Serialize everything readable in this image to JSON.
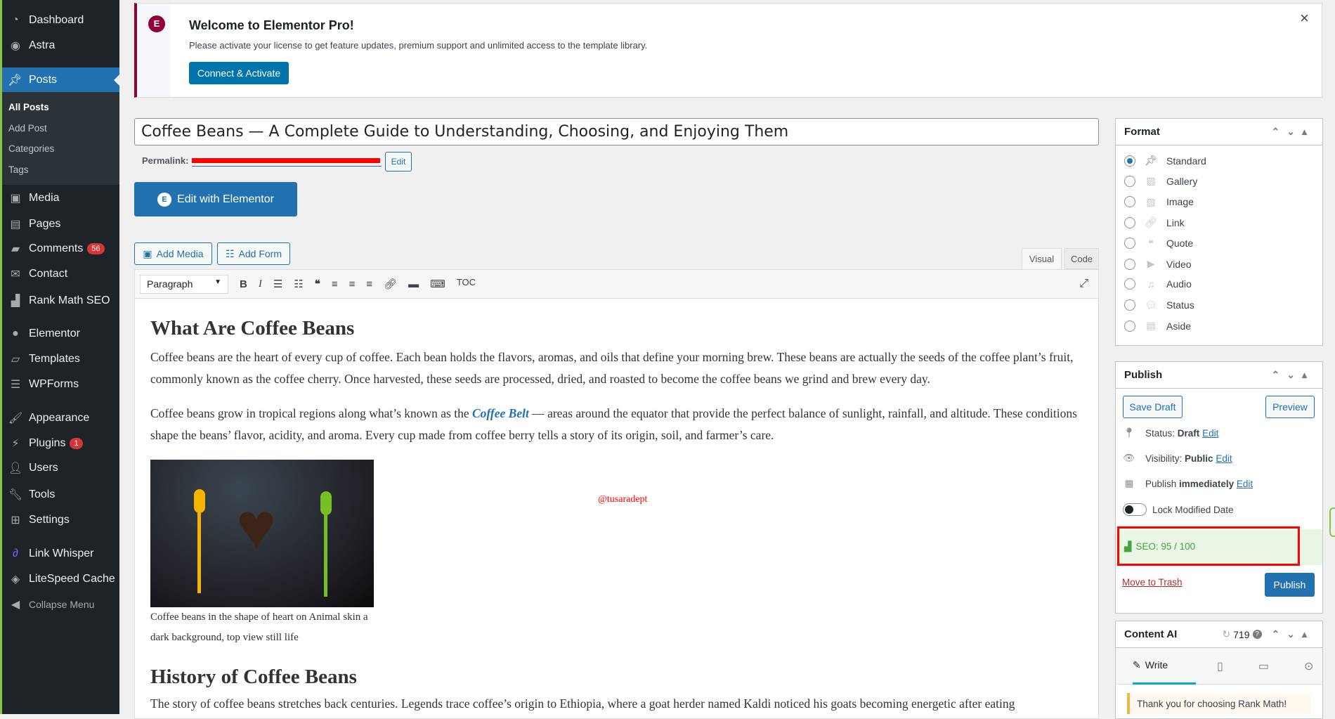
{
  "sidebar": {
    "items": [
      {
        "label": "Dashboard",
        "icon": "dashboard-icon"
      },
      {
        "label": "Astra",
        "icon": "astra-icon"
      },
      {
        "label": "Posts",
        "icon": "pin-icon"
      },
      {
        "label": "Media",
        "icon": "media-icon"
      },
      {
        "label": "Pages",
        "icon": "pages-icon"
      },
      {
        "label": "Comments",
        "icon": "comment-icon",
        "badge": "56"
      },
      {
        "label": "Contact",
        "icon": "mail-icon"
      },
      {
        "label": "Rank Math SEO",
        "icon": "rankmath-icon"
      },
      {
        "label": "Elementor",
        "icon": "elementor-icon"
      },
      {
        "label": "Templates",
        "icon": "folder-icon"
      },
      {
        "label": "WPForms",
        "icon": "forms-icon"
      },
      {
        "label": "Appearance",
        "icon": "brush-icon"
      },
      {
        "label": "Plugins",
        "icon": "plugin-icon",
        "badge": "1"
      },
      {
        "label": "Users",
        "icon": "user-icon"
      },
      {
        "label": "Tools",
        "icon": "wrench-icon"
      },
      {
        "label": "Settings",
        "icon": "settings-icon"
      },
      {
        "label": "Link Whisper",
        "icon": "link-icon"
      },
      {
        "label": "LiteSpeed Cache",
        "icon": "litespeed-icon"
      },
      {
        "label": "Collapse Menu",
        "icon": "collapse-icon"
      }
    ],
    "submenu": [
      "All Posts",
      "Add Post",
      "Categories",
      "Tags"
    ]
  },
  "notice": {
    "title": "Welcome to Elementor Pro!",
    "text": "Please activate your license to get feature updates, premium support and unlimited access to the template library.",
    "button": "Connect & Activate",
    "close": "×"
  },
  "editor": {
    "title": "Coffee Beans — A Complete Guide to Understanding, Choosing, and Enjoying Them",
    "permalink_label": "Permalink:",
    "permalink_edit": "Edit",
    "elementor_button": "Edit with Elementor",
    "add_media": "Add Media",
    "add_form": "Add Form",
    "tab_visual": "Visual",
    "tab_code": "Code",
    "format_select": "Paragraph",
    "toc": "TOC"
  },
  "content": {
    "h1": "What Are Coffee Beans",
    "p1": "Coffee beans are the heart of every cup of coffee. Each bean holds the flavors, aromas, and oils that define your morning brew. These beans are actually the seeds of the coffee plant’s fruit, commonly known as the coffee cherry. Once harvested, these seeds are processed, dried, and roasted to become the coffee beans we grind and brew every day.",
    "p2a": "Coffee beans grow in tropical regions along what’s known as the ",
    "p2link": "Coffee Belt",
    "p2b": " — areas around the equator that provide the perfect balance of sunlight, rainfall, and altitude. These conditions shape the beans’ flavor, acidity, and aroma. Every cup made from coffee berry tells a story of its origin, soil, and farmer’s care.",
    "caption": "Coffee beans in the shape of heart on Animal skin a dark background, top view still life",
    "watermark": "@tusaradept",
    "h2": "History of Coffee Beans",
    "p3": "The story of coffee beans stretches back centuries. Legends trace coffee’s origin to Ethiopia, where a goat herder named Kaldi noticed his goats becoming energetic after eating"
  },
  "format": {
    "title": "Format",
    "options": [
      "Standard",
      "Gallery",
      "Image",
      "Link",
      "Quote",
      "Video",
      "Audio",
      "Status",
      "Aside"
    ],
    "selected": "Standard"
  },
  "publish": {
    "title": "Publish",
    "save_draft": "Save Draft",
    "preview": "Preview",
    "status_label": "Status:",
    "status": "Draft",
    "visibility_label": "Visibility:",
    "visibility": "Public",
    "publish_label": "Publish",
    "publish_when": "immediately",
    "edit": "Edit",
    "lock": "Lock Modified Date",
    "seo": "SEO: 95 / 100",
    "trash": "Move to Trash",
    "publish_button": "Publish"
  },
  "content_ai": {
    "title": "Content AI",
    "credits": "719",
    "write_tab": "Write",
    "notice": "Thank you for choosing Rank Math!"
  },
  "colors": {
    "accent": "#2271b1",
    "sidebar": "#1d2327",
    "seo_green": "#46a341",
    "notice_border": "#92003b"
  }
}
